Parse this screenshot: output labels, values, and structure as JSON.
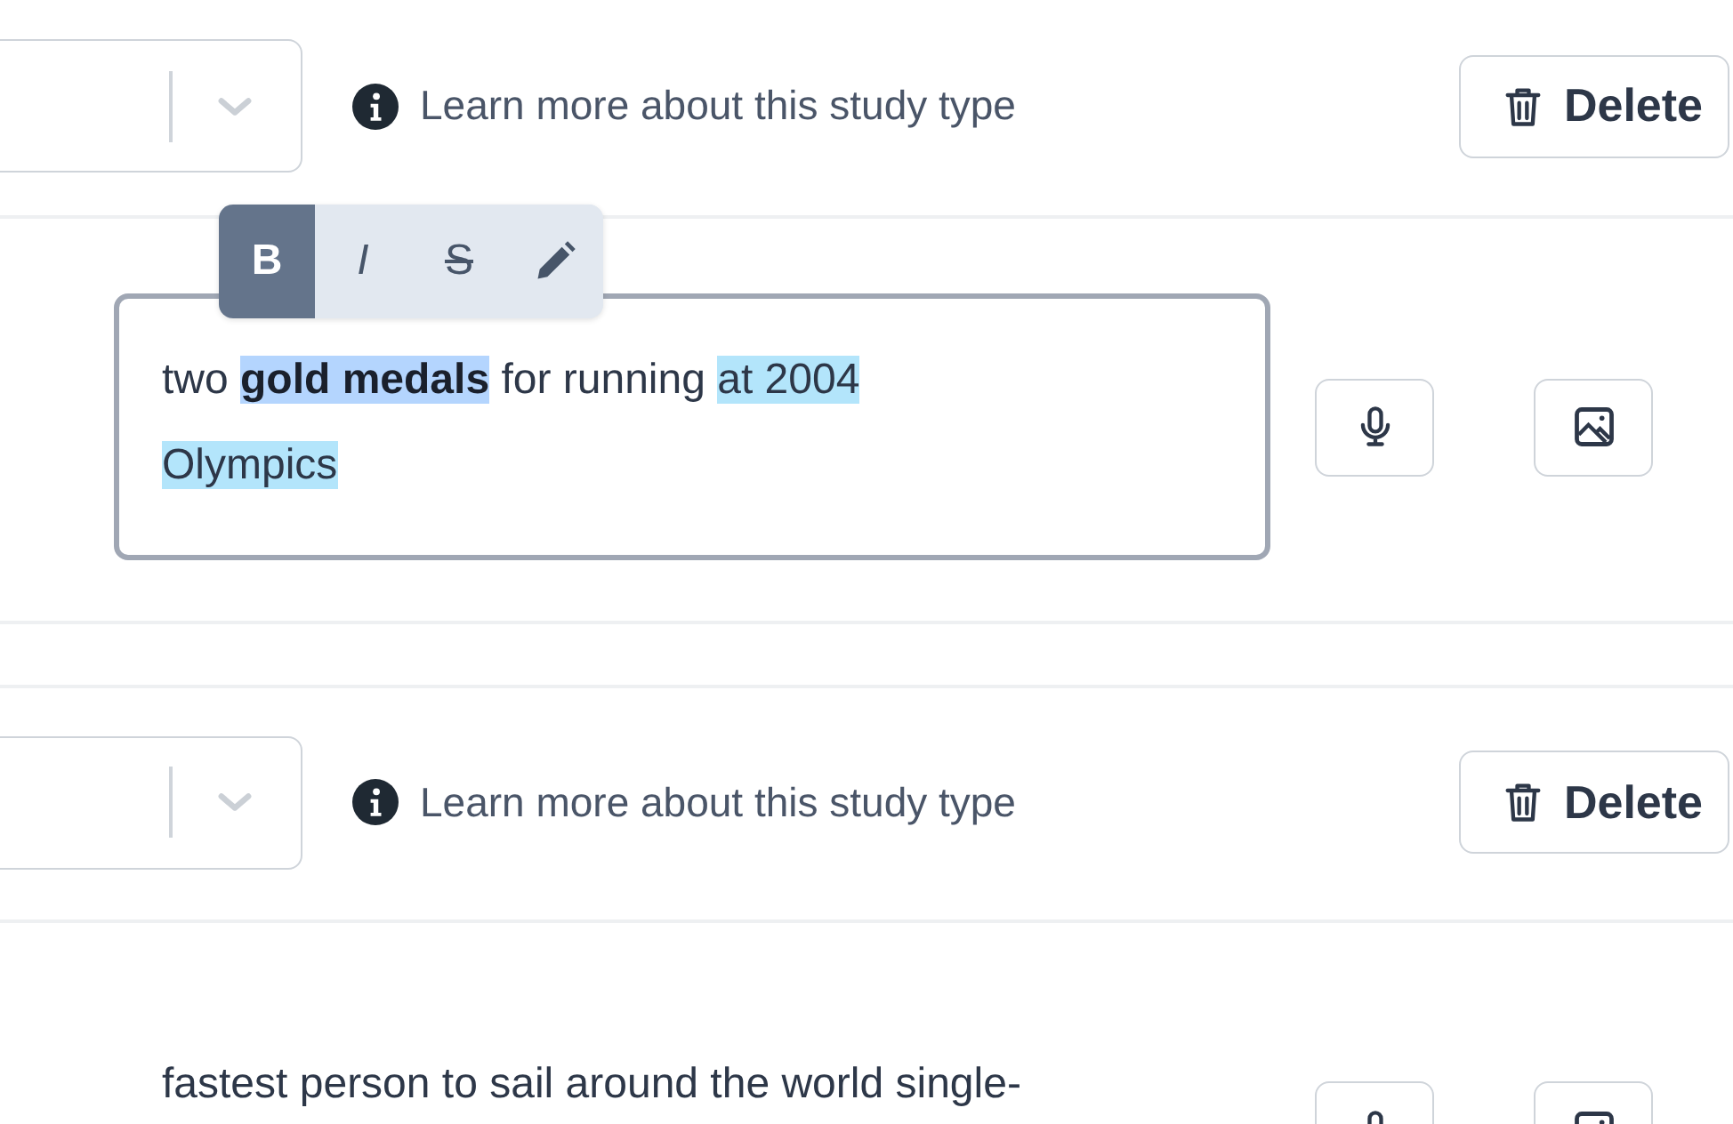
{
  "sections": [
    {
      "study_type": {
        "info_link": "Learn more about this study type",
        "delete_button": "Delete"
      },
      "answer": {
        "focused": true,
        "toolbar": [
          {
            "kind": "bold",
            "label": "B",
            "selected": true
          },
          {
            "kind": "italic",
            "label": "I",
            "selected": false
          },
          {
            "kind": "strike",
            "label": "S",
            "selected": false
          },
          {
            "kind": "pencil",
            "selected": false
          }
        ],
        "segments": [
          {
            "text": "two "
          },
          {
            "text": "**gold medals**",
            "color": "#b4d5fe"
          },
          {
            "text": " for running "
          },
          {
            "text": "at 2004 Olympics",
            "color": "#b3e5fb"
          }
        ]
      }
    },
    {
      "study_type": {
        "info_link": "Learn more about this study type",
        "delete_button": "Delete"
      },
      "answer": {
        "focused": false,
        "segments": [
          {
            "text": "fastest person to sail around the world single-"
          }
        ]
      }
    }
  ]
}
